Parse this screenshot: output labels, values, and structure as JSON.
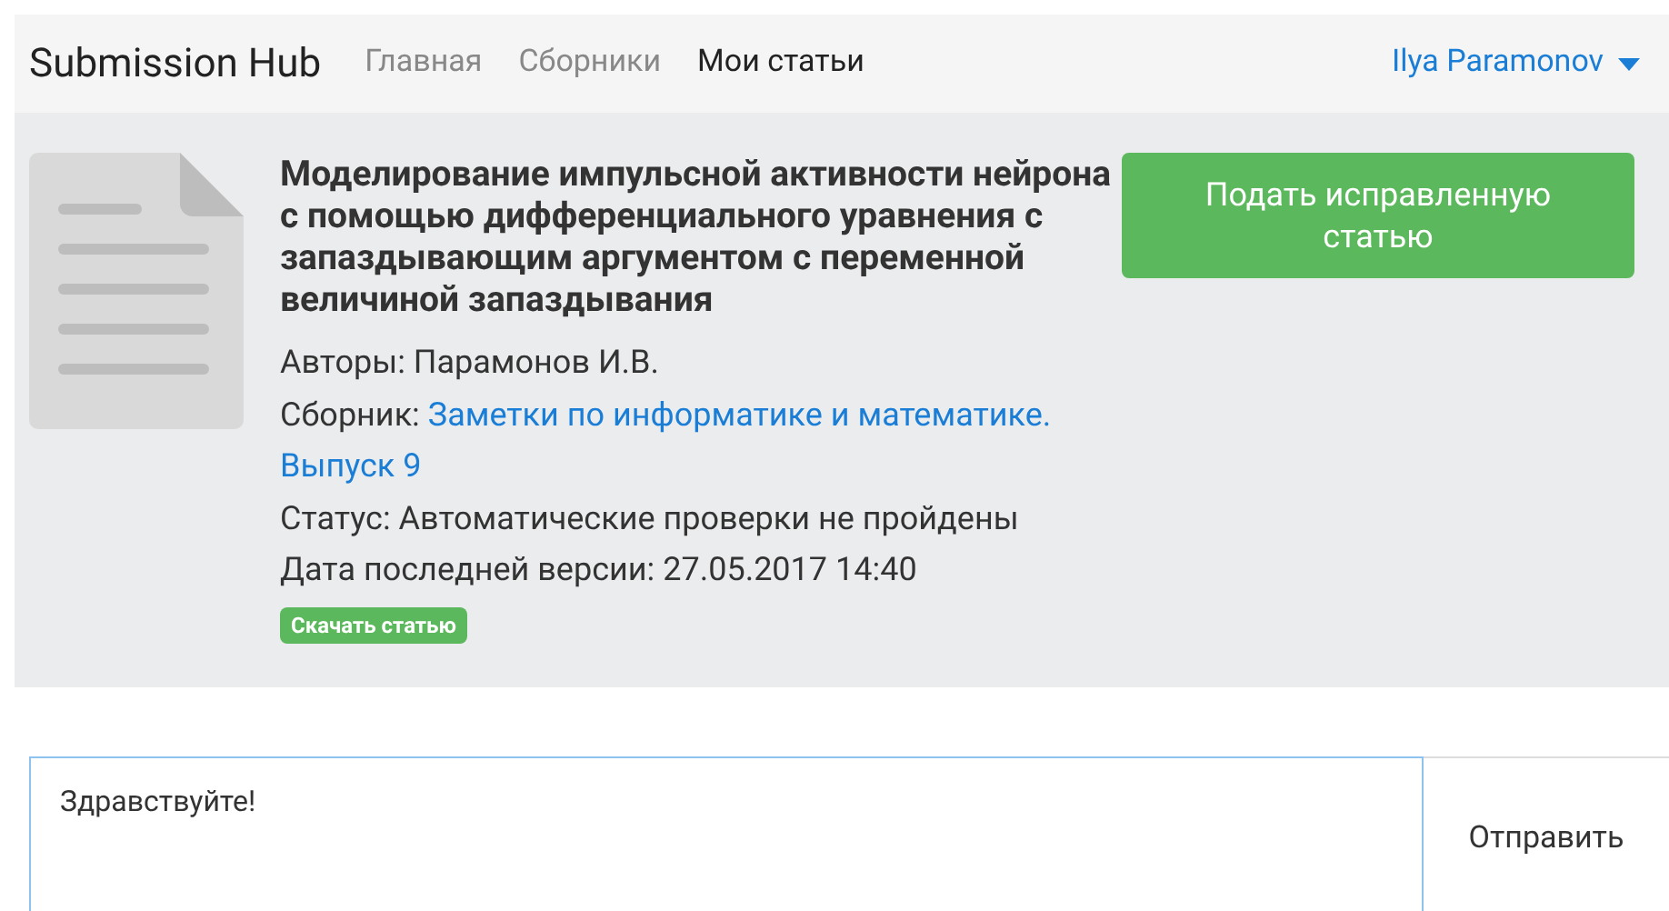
{
  "navbar": {
    "brand": "Submission Hub",
    "items": [
      {
        "label": "Главная",
        "selected": false
      },
      {
        "label": "Сборники",
        "selected": false
      },
      {
        "label": "Мои статьи",
        "selected": true
      }
    ],
    "user": "Ilya Paramonov"
  },
  "article": {
    "title": "Моделирование импульсной активности нейрона с помощью дифференциального уравнения с запаздывающим аргументом с переменной величиной запаздывания",
    "authors_label": "Авторы:",
    "authors": "Парамонов И.В.",
    "collection_label": "Сборник:",
    "collection": "Заметки по информатике и математике. Выпуск 9",
    "status_label": "Статус:",
    "status": "Автоматические проверки не пройдены",
    "date_label": "Дата последней версии:",
    "date": "27.05.2017 14:40",
    "download": "Скачать статью",
    "resubmit": "Подать исправленную статью"
  },
  "message": {
    "value": "Здравствуйте!",
    "send": "Отправить"
  }
}
